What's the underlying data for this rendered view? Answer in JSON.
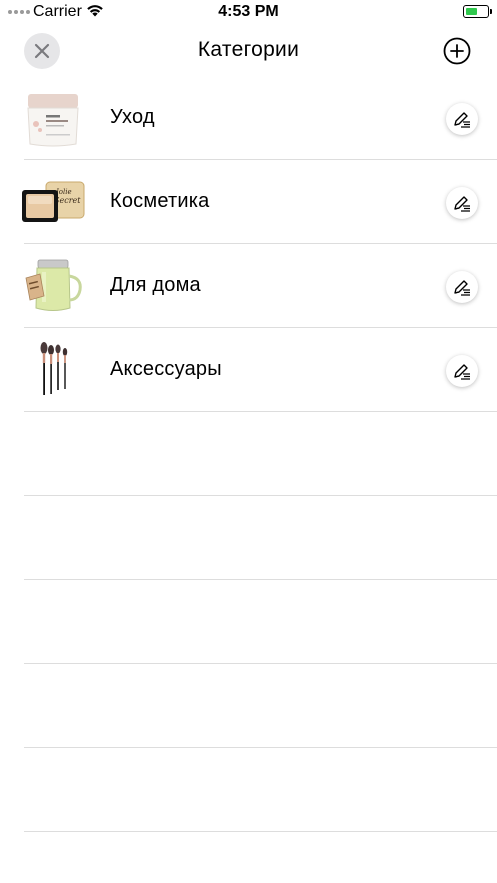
{
  "status_bar": {
    "carrier": "Carrier",
    "time": "4:53 PM",
    "battery_color": "#2fc84d"
  },
  "nav": {
    "title": "Категории",
    "close_icon": "close-icon",
    "add_icon": "plus-circle-icon"
  },
  "categories": [
    {
      "label": "Уход",
      "thumb": "face-cream-jar",
      "edit_icon": "pencil-list-icon"
    },
    {
      "label": "Косметика",
      "thumb": "compact-powder",
      "edit_icon": "pencil-list-icon"
    },
    {
      "label": "Для дома",
      "thumb": "candle-jar",
      "edit_icon": "pencil-list-icon"
    },
    {
      "label": "Аксессуары",
      "thumb": "makeup-brushes",
      "edit_icon": "pencil-list-icon"
    }
  ]
}
